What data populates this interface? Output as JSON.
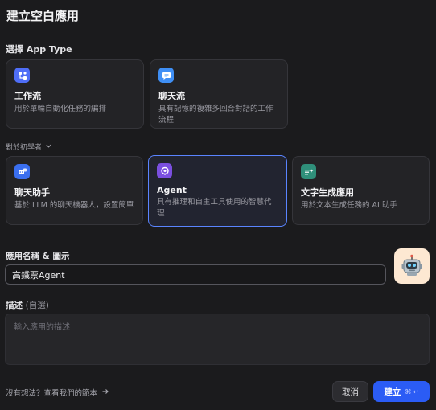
{
  "dialog": {
    "title": "建立空白應用"
  },
  "app_type": {
    "label": "選擇 App Type",
    "cards": [
      {
        "title": "工作流",
        "desc": "用於單輪自動化任務的編排",
        "icon": "workflow-icon",
        "color": "#4f6ef7"
      },
      {
        "title": "聊天流",
        "desc": "具有記憶的複雜多回合對話的工作流程",
        "icon": "chatflow-icon",
        "color": "#3f8ff5"
      }
    ],
    "beginner_toggle": "對於初學者",
    "beginner_cards": [
      {
        "title": "聊天助手",
        "desc": "基於 LLM 的聊天機器人，設置簡單",
        "icon": "chatbot-icon",
        "color": "#3a6ff0"
      },
      {
        "title": "Agent",
        "desc": "具有推理和自主工具使用的智慧代理",
        "icon": "agent-icon",
        "color": "#7b4fe0",
        "selected": true
      },
      {
        "title": "文字生成應用",
        "desc": "用於文本生成任務的 AI 助手",
        "icon": "text-generation-icon",
        "color": "#2f8f7a"
      }
    ]
  },
  "name_field": {
    "label": "應用名稱 & 圖示",
    "value": "高鐵票Agent",
    "avatar_icon": "robot-icon"
  },
  "description_field": {
    "label": "描述",
    "optional": "(自選)",
    "placeholder": "輸入應用的描述"
  },
  "footer": {
    "template_link": "沒有想法？查看我們的範本",
    "cancel_label": "取消",
    "create_label": "建立",
    "create_shortcut": "⌘ ↵"
  }
}
